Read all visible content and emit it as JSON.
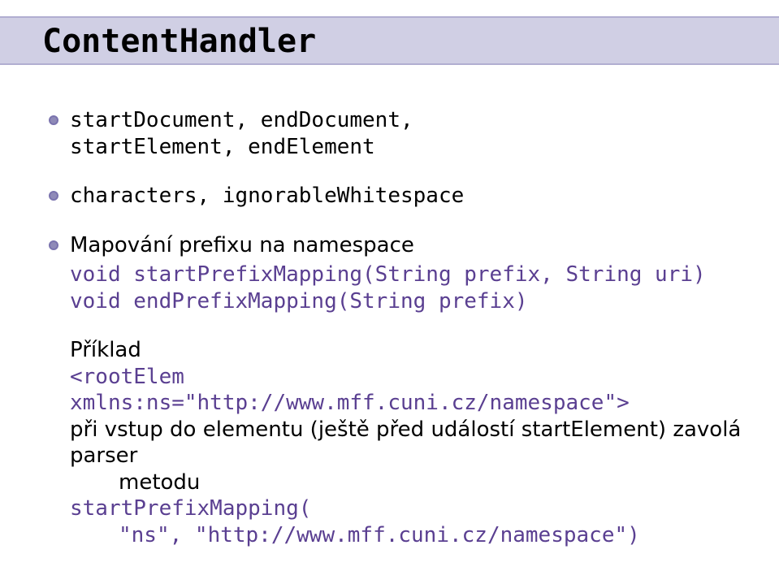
{
  "title": "ContentHandler",
  "bullets": {
    "b1": {
      "line1": "startDocument, endDocument,",
      "line2": "startElement, endElement"
    },
    "b2": "characters, ignorableWhitespace",
    "b3": {
      "heading": "Mapování prefixu na namespace",
      "code1": "void startPrefixMapping(String prefix, String uri)",
      "code2": "void endPrefixMapping(String prefix)"
    }
  },
  "example": {
    "label": "Příklad",
    "xml": "<rootElem xmlns:ns=\"http://www.mff.cuni.cz/namespace\">",
    "prose1": "při vstup do elementu (ještě před událostí startElement) zavolá parser",
    "prose2_indent": "metodu",
    "call_open": "startPrefixMapping(",
    "call_args": "\"ns\", \"http://www.mff.cuni.cz/namespace\")"
  }
}
